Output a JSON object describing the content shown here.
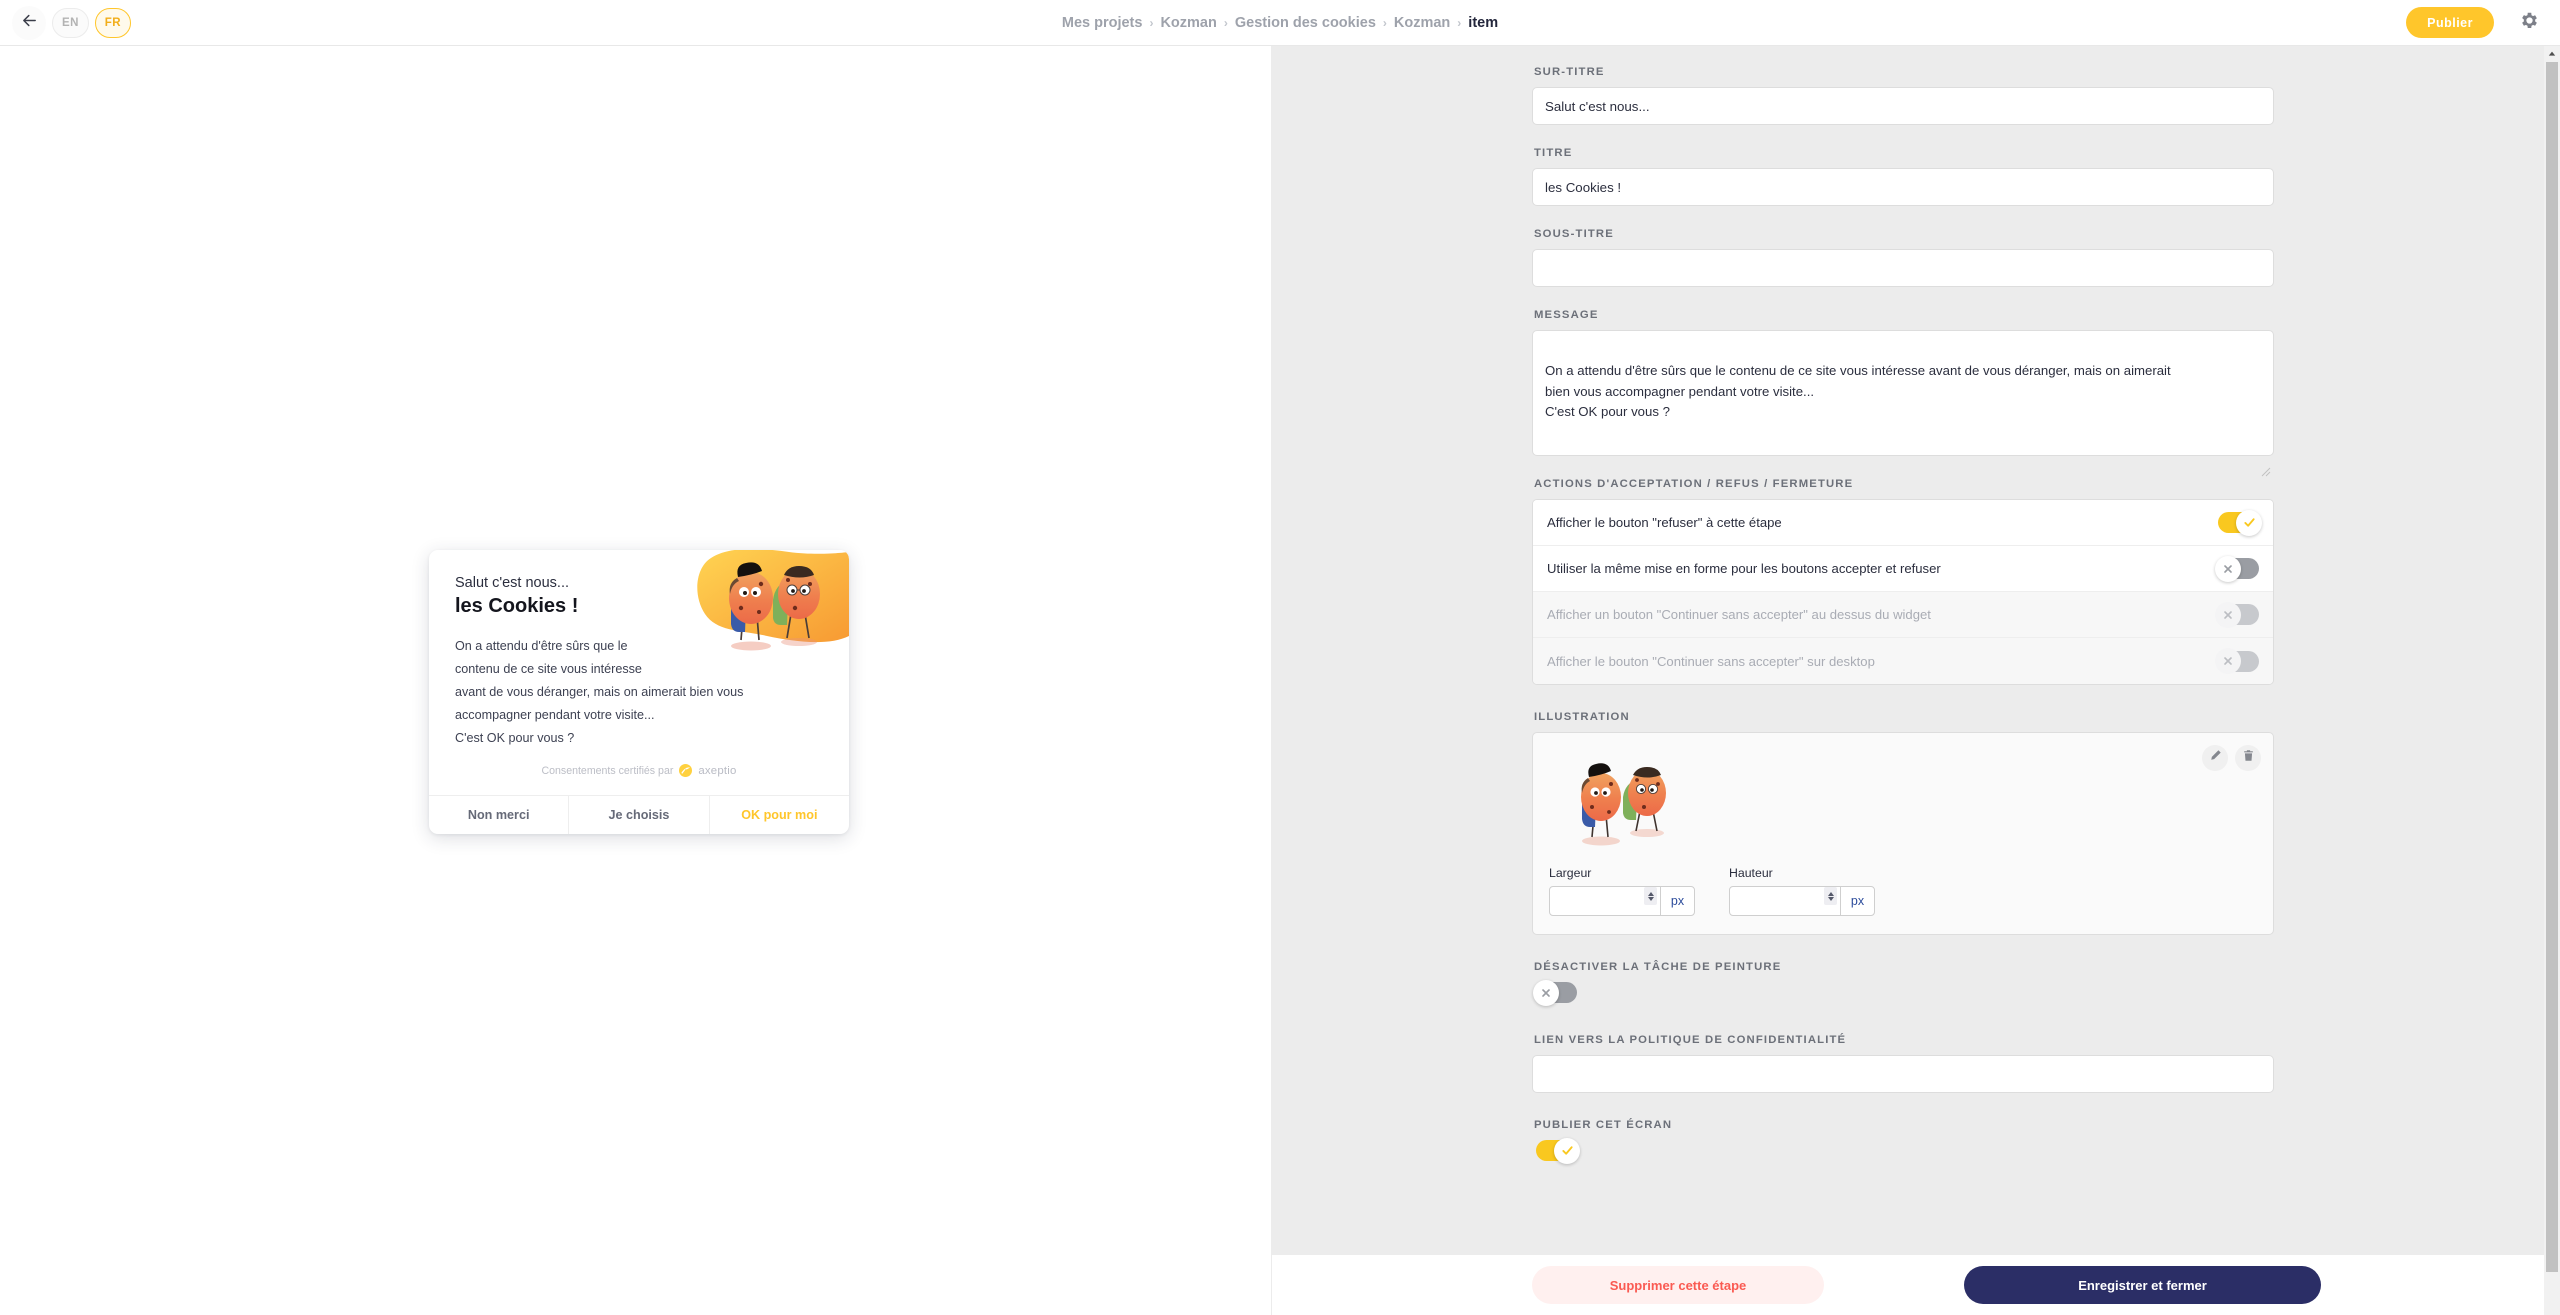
{
  "topbar": {
    "back_icon": "arrow-left-icon",
    "languages": [
      {
        "code": "EN",
        "active": false
      },
      {
        "code": "FR",
        "active": true
      }
    ],
    "breadcrumb": [
      {
        "label": "Mes projets",
        "current": false
      },
      {
        "label": "Kozman",
        "current": false
      },
      {
        "label": "Gestion des cookies",
        "current": false
      },
      {
        "label": "Kozman",
        "current": false
      },
      {
        "label": "item",
        "current": true
      }
    ],
    "breadcrumb_separator": "›",
    "publish_label": "Publier",
    "settings_icon": "gear-icon"
  },
  "preview": {
    "widget": {
      "surtitre": "Salut c'est nous...",
      "titre": "les Cookies !",
      "message": "On a attendu d'être sûrs que le\ncontenu de ce site vous intéresse\navant de vous déranger, mais on aimerait bien vous\naccompagner pendant votre visite...\nC'est OK pour vous ?",
      "certified_text": "Consentements certifiés par",
      "brand_name": "axeptio",
      "actions": {
        "decline": "Non merci",
        "choose": "Je choisis",
        "accept": "OK pour moi"
      }
    }
  },
  "form": {
    "surtitre": {
      "label": "SUR-TITRE",
      "value": "Salut c'est nous...",
      "placeholder": ""
    },
    "titre": {
      "label": "TITRE",
      "value": "les Cookies !",
      "placeholder": ""
    },
    "sous_titre": {
      "label": "SOUS-TITRE",
      "value": "",
      "placeholder": ""
    },
    "message": {
      "label": "MESSAGE",
      "value": "On a attendu d'être sûrs que le contenu de ce site vous intéresse avant de vous déranger, mais on aimerait\nbien vous accompagner pendant votre visite...\nC'est OK pour vous ?",
      "placeholder": ""
    },
    "actions_section": {
      "label": "ACTIONS D'ACCEPTATION / REFUS / FERMETURE",
      "rows": [
        {
          "label": "Afficher le bouton \"refuser\" à cette étape",
          "state": "on",
          "disabled": false
        },
        {
          "label": "Utiliser la même mise en forme pour les boutons accepter et refuser",
          "state": "off",
          "disabled": false
        },
        {
          "label": "Afficher un bouton \"Continuer sans accepter\" au dessus du widget",
          "state": "off",
          "disabled": true
        },
        {
          "label": "Afficher le bouton \"Continuer sans accepter\" sur desktop",
          "state": "off",
          "disabled": true
        }
      ]
    },
    "illustration": {
      "label": "ILLUSTRATION",
      "edit_icon": "pencil-icon",
      "delete_icon": "trash-icon",
      "width": {
        "label": "Largeur",
        "value": "",
        "unit": "px"
      },
      "height": {
        "label": "Hauteur",
        "value": "",
        "unit": "px"
      }
    },
    "paint_stain": {
      "label": "DÉSACTIVER LA TÂCHE DE PEINTURE",
      "state": "off"
    },
    "privacy_link": {
      "label": "LIEN VERS LA POLITIQUE DE CONFIDENTIALITÉ",
      "value": "",
      "placeholder": ""
    },
    "publish_screen": {
      "label": "PUBLIER CET ÉCRAN",
      "state": "on"
    }
  },
  "action_bar": {
    "delete_label": "Supprimer cette étape",
    "save_label": "Enregistrer et fermer"
  },
  "colors": {
    "accent_yellow": "#ffc62b",
    "toggle_on": "#f9c81f",
    "toggle_off": "#9a9da3",
    "danger": "#fa5a52",
    "primary_dark": "#2b2e66",
    "panel_bg": "#ececec"
  }
}
